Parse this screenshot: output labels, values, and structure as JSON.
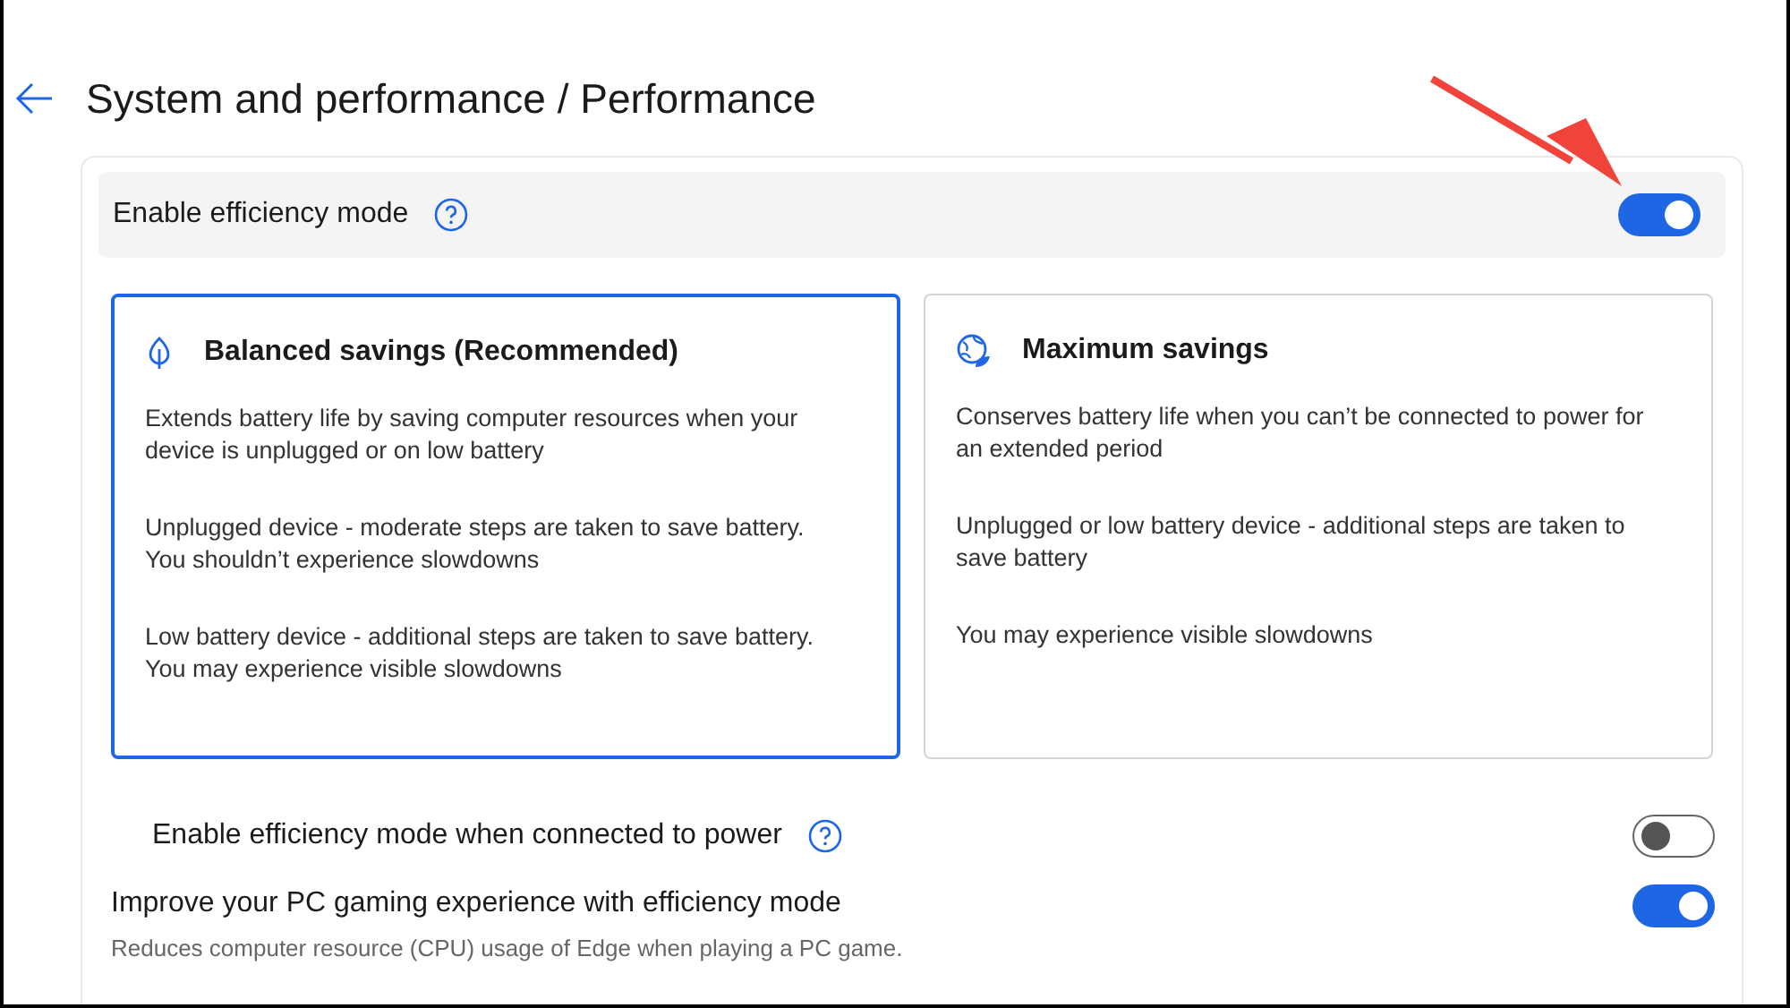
{
  "header": {
    "title": "System and performance / Performance"
  },
  "main_toggle": {
    "label": "Enable efficiency mode",
    "help": true,
    "on": true
  },
  "modes": [
    {
      "kind": "leaf",
      "title": "Balanced savings (Recommended)",
      "selected": true,
      "paragraphs": [
        "Extends battery life by saving computer resources when your device is unplugged or on low battery",
        "Unplugged device - moderate steps are taken to save battery. You shouldn’t experience slowdowns",
        "Low battery device - additional steps are taken to save battery. You may experience visible slowdowns"
      ]
    },
    {
      "kind": "globe",
      "title": "Maximum savings",
      "selected": false,
      "paragraphs": [
        "Conserves battery life when you can’t be connected to power for an extended period",
        "Unplugged or low battery device - additional steps are taken to save battery",
        "You may experience visible slowdowns"
      ]
    }
  ],
  "settings": [
    {
      "kind": "sub",
      "label": "Enable efficiency mode when connected to power",
      "help": true,
      "on": false
    },
    {
      "kind": "main",
      "label": "Improve your PC gaming experience with efficiency mode",
      "description": "Reduces computer resource (CPU) usage of Edge when playing a PC game.",
      "help": false,
      "on": true
    }
  ]
}
